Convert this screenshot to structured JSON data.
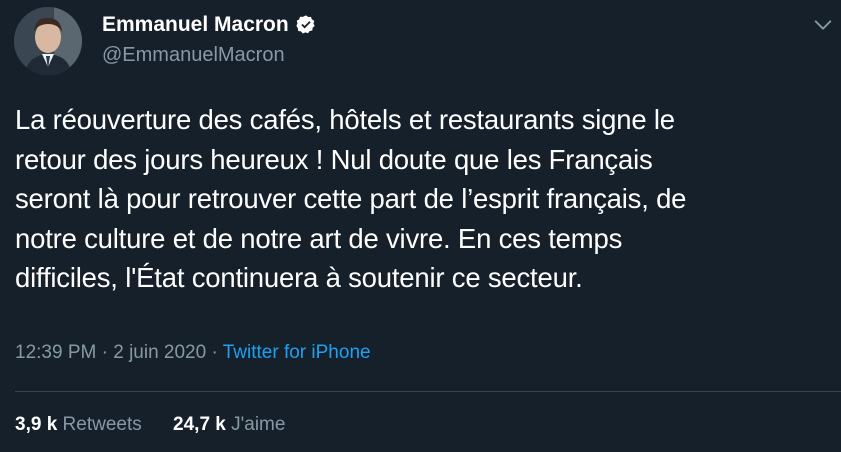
{
  "author": {
    "display_name": "Emmanuel Macron",
    "handle": "@EmmanuelMacron",
    "verified": true,
    "avatar_icon": "avatar-photo-icon"
  },
  "tweet": {
    "text_lines": [
      "La réouverture des cafés, hôtels et restaurants signe le",
      "retour des jours heureux ! Nul doute que les Français",
      "seront là pour retrouver cette part de l’esprit français, de",
      "notre culture et de notre art de vivre. En ces temps",
      "difficiles, l'État continuera à soutenir ce secteur."
    ],
    "time": "12:39 PM",
    "separator": "·",
    "date": "2 juin 2020",
    "source": "Twitter for iPhone"
  },
  "stats": {
    "retweets_count": "3,9 k",
    "retweets_label": "Retweets",
    "likes_count": "24,7 k",
    "likes_label": "J'aime"
  },
  "colors": {
    "background": "#15202b",
    "text": "#ffffff",
    "muted": "#8899a6",
    "accent": "#1da1f2",
    "divider": "#38444d"
  }
}
